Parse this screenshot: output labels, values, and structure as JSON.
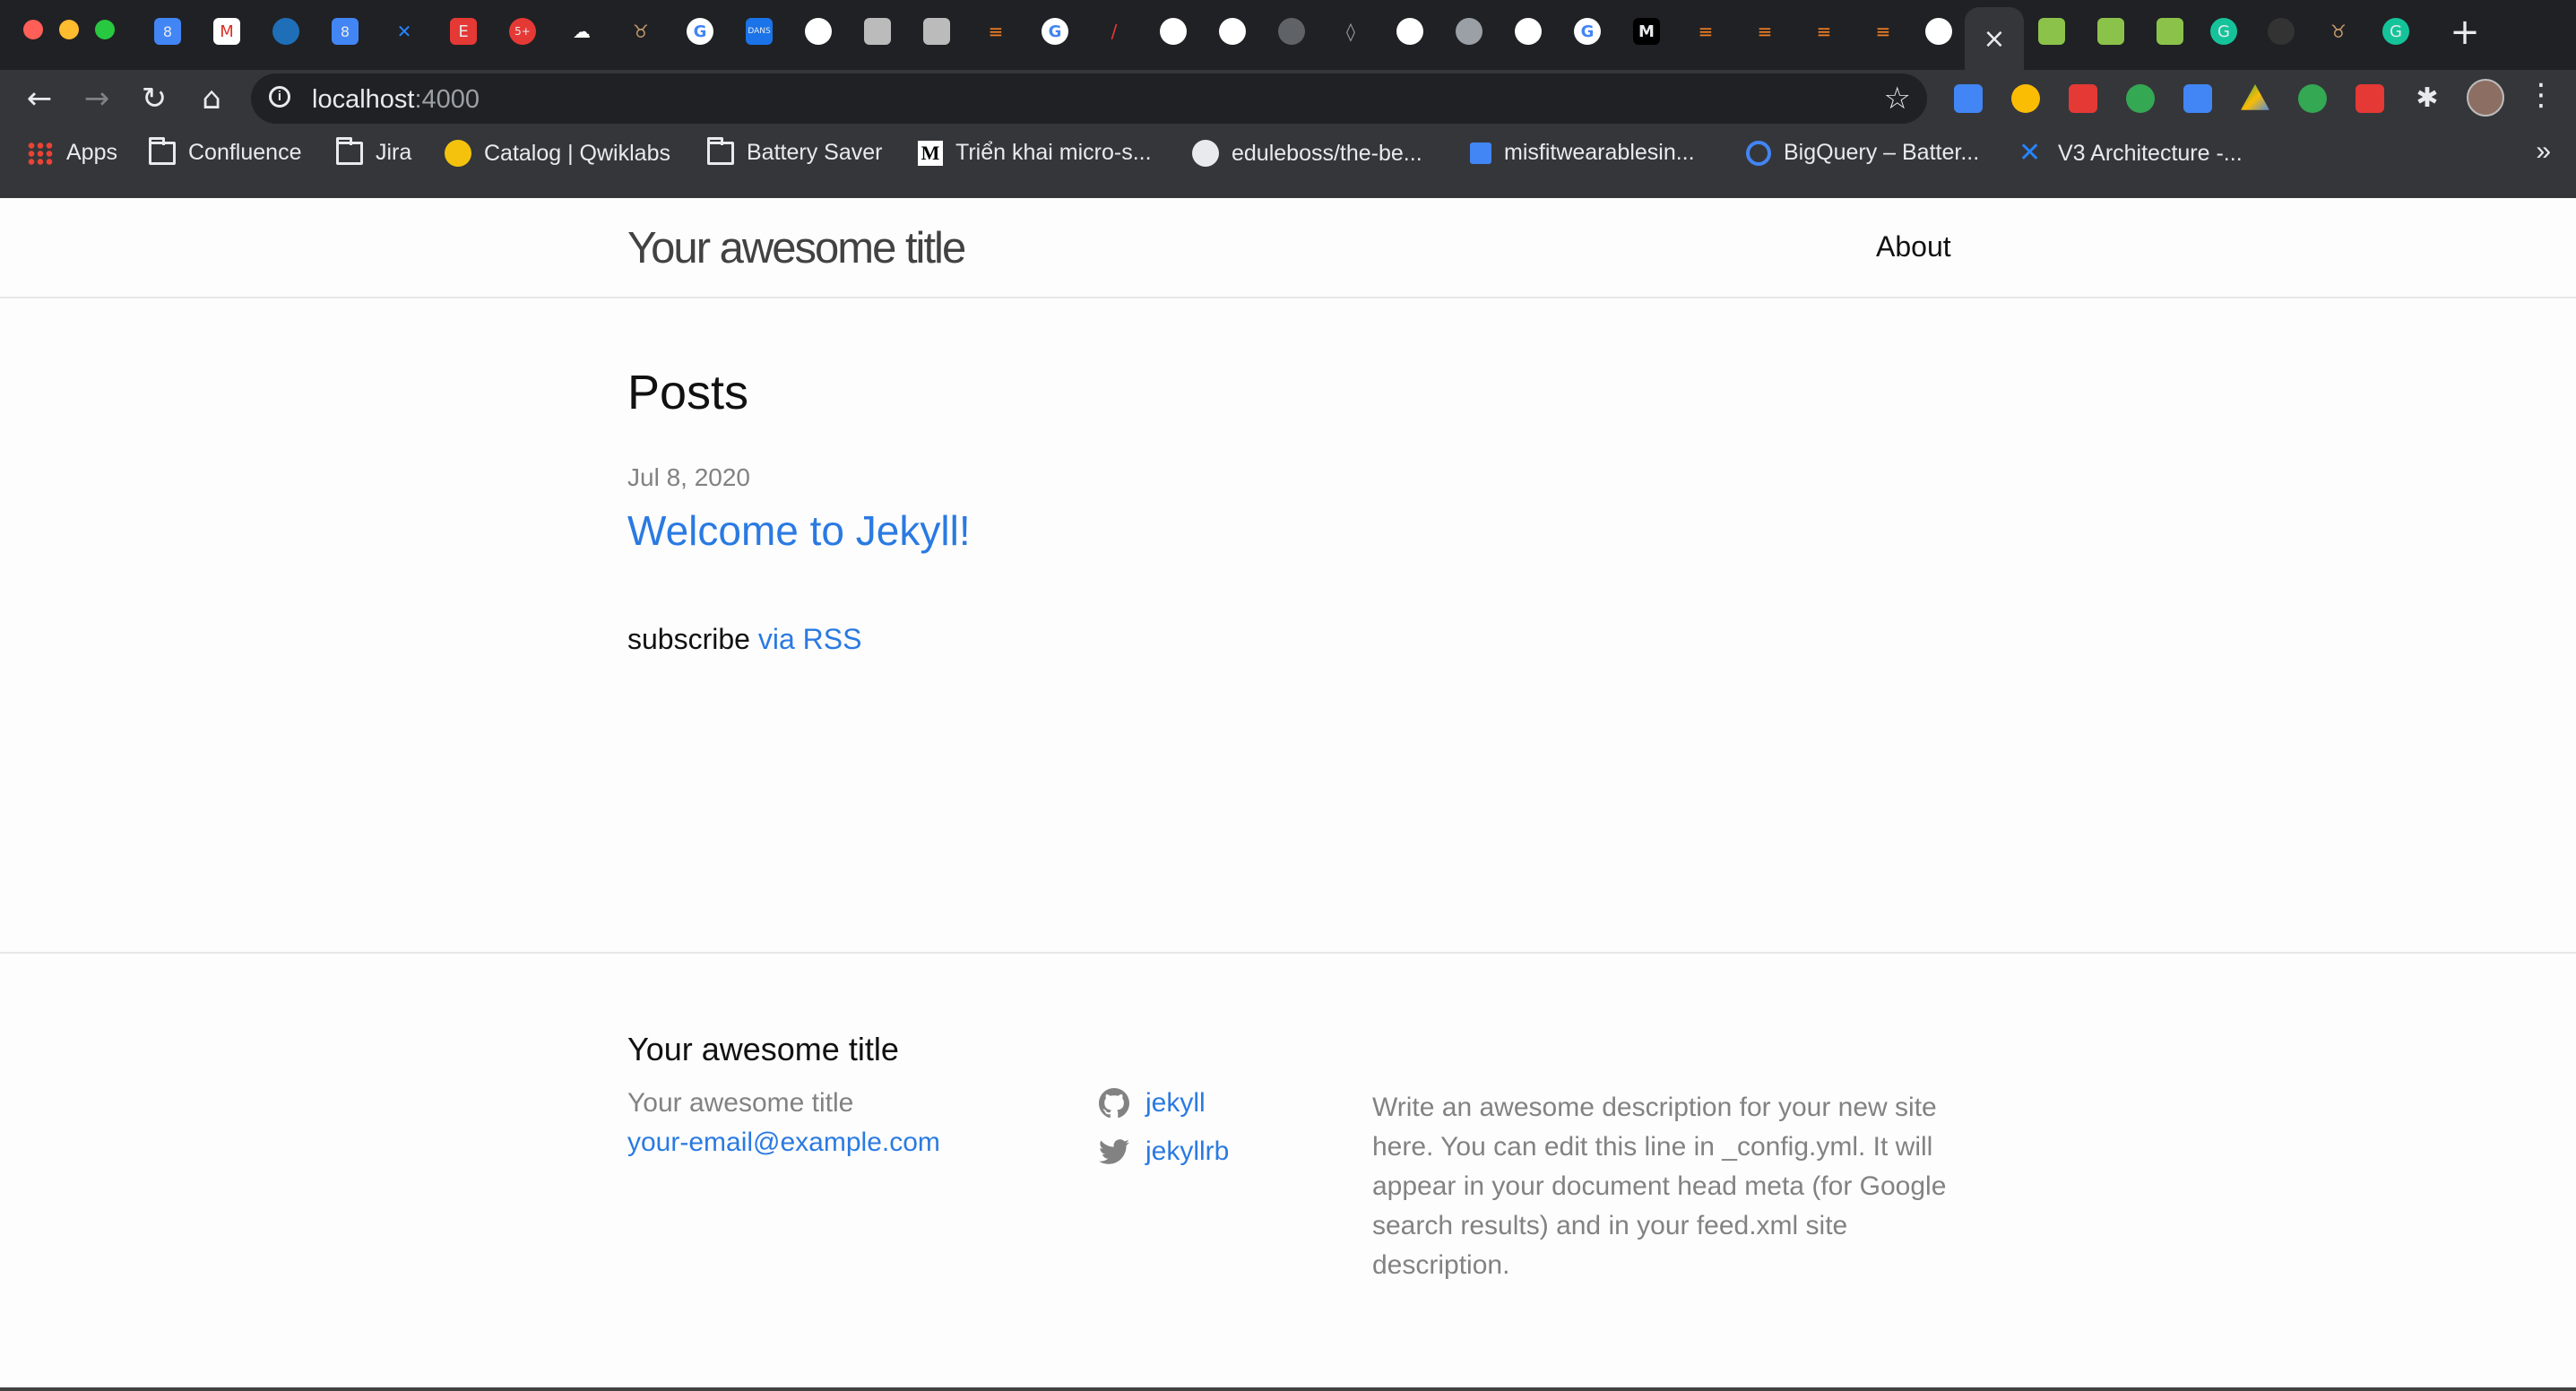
{
  "browser": {
    "url_host": "localhost",
    "url_port": ":4000",
    "active_tab_close": "×",
    "new_tab": "+",
    "bookmarks": [
      {
        "label": "Apps",
        "icon": "apps-grid-icon"
      },
      {
        "label": "Confluence",
        "icon": "folder-icon"
      },
      {
        "label": "Jira",
        "icon": "folder-icon"
      },
      {
        "label": "Catalog | Qwiklabs",
        "icon": "qwiklabs-icon"
      },
      {
        "label": "Battery Saver",
        "icon": "folder-icon"
      },
      {
        "label": "Triển khai micro-s...",
        "icon": "medium-icon"
      },
      {
        "label": "eduleboss/the-be...",
        "icon": "github-icon"
      },
      {
        "label": "misfitwearablesin...",
        "icon": "bookmark-icon"
      },
      {
        "label": "BigQuery – Batter...",
        "icon": "bigquery-icon"
      },
      {
        "label": "V3 Architecture -...",
        "icon": "confluence-icon"
      }
    ],
    "overflow": "»"
  },
  "site": {
    "title": "Your awesome title",
    "nav": {
      "about": "About"
    }
  },
  "main": {
    "heading": "Posts",
    "posts": [
      {
        "date": "Jul 8, 2020",
        "title": "Welcome to Jekyll!"
      }
    ],
    "subscribe_text": "subscribe",
    "subscribe_link": "via RSS"
  },
  "footer": {
    "heading": "Your awesome title",
    "name": "Your awesome title",
    "email": "your-email@example.com",
    "github_user": "jekyll",
    "twitter_user": "jekyllrb",
    "description": "Write an awesome description for your new site here. You can edit this line in _config.yml. It will appear in your document head meta (for Google search results) and in your feed.xml site description."
  }
}
